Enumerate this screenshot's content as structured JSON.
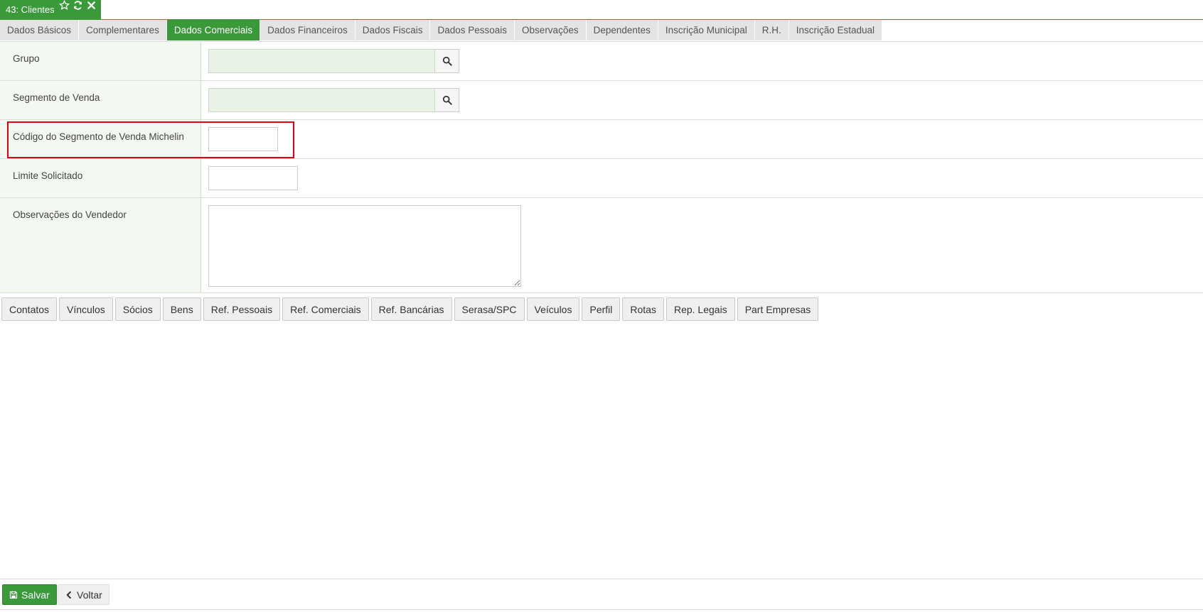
{
  "window": {
    "title": "43: Clientes",
    "icons": [
      "star-icon",
      "refresh-icon",
      "close-icon"
    ],
    "accent_color": "#3a9a3a"
  },
  "tabs": [
    {
      "label": "Dados Básicos",
      "active": false
    },
    {
      "label": "Complementares",
      "active": false
    },
    {
      "label": "Dados Comerciais",
      "active": true
    },
    {
      "label": "Dados Financeiros",
      "active": false
    },
    {
      "label": "Dados Fiscais",
      "active": false
    },
    {
      "label": "Dados Pessoais",
      "active": false
    },
    {
      "label": "Observações",
      "active": false
    },
    {
      "label": "Dependentes",
      "active": false
    },
    {
      "label": "Inscrição Municipal",
      "active": false
    },
    {
      "label": "R.H.",
      "active": false
    },
    {
      "label": "Inscrição Estadual",
      "active": false
    }
  ],
  "form": {
    "grupo": {
      "label": "Grupo",
      "value": ""
    },
    "segmento": {
      "label": "Segmento de Venda",
      "value": ""
    },
    "codigo_michelin": {
      "label": "Código do Segmento de Venda Michelin",
      "value": "",
      "highlight_color": "#e3000f"
    },
    "limite": {
      "label": "Limite Solicitado",
      "value": ""
    },
    "observacoes": {
      "label": "Observações do Vendedor",
      "value": ""
    }
  },
  "sub_buttons": [
    "Contatos",
    "Vínculos",
    "Sócios",
    "Bens",
    "Ref. Pessoais",
    "Ref. Comerciais",
    "Ref. Bancárias",
    "Serasa/SPC",
    "Veículos",
    "Perfil",
    "Rotas",
    "Rep. Legais",
    "Part Empresas"
  ],
  "footer": {
    "save_label": "Salvar",
    "back_label": "Voltar"
  }
}
